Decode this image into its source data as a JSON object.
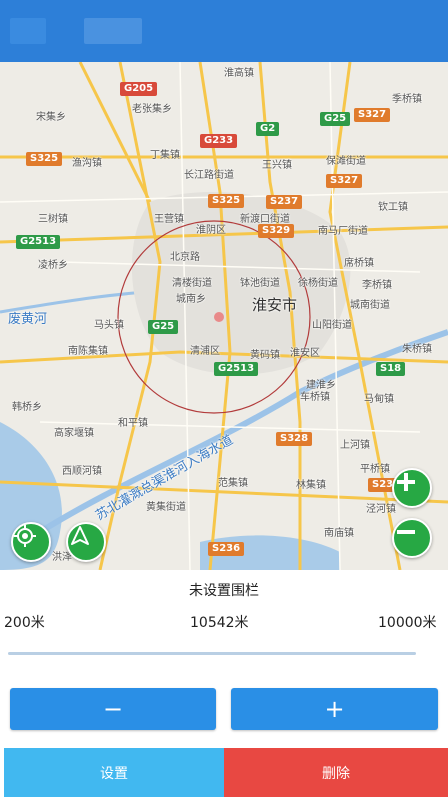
{
  "map": {
    "city_label": "淮安市",
    "water_labels": {
      "river": "废黄河",
      "canal": "苏北灌溉总渠淮河入海水道"
    },
    "route_shields": [
      {
        "text": "G205",
        "color": "red"
      },
      {
        "text": "G233",
        "color": "red"
      },
      {
        "text": "G2",
        "color": "green"
      },
      {
        "text": "G25",
        "color": "green"
      },
      {
        "text": "S327",
        "color": "orange"
      },
      {
        "text": "S325",
        "color": "orange"
      },
      {
        "text": "S237",
        "color": "orange"
      },
      {
        "text": "S325",
        "color": "orange"
      },
      {
        "text": "S327",
        "color": "orange"
      },
      {
        "text": "G2513",
        "color": "green"
      },
      {
        "text": "S329",
        "color": "orange"
      },
      {
        "text": "G25",
        "color": "green"
      },
      {
        "text": "G2513",
        "color": "green"
      },
      {
        "text": "S18",
        "color": "green"
      },
      {
        "text": "S328",
        "color": "orange"
      },
      {
        "text": "S237",
        "color": "orange"
      },
      {
        "text": "S236",
        "color": "orange"
      }
    ],
    "places": [
      "淮高镇",
      "季桥镇",
      "老张集乡",
      "宋集乡",
      "渔沟镇",
      "丁集镇",
      "长江路街道",
      "王兴镇",
      "保滩街道",
      "三树镇",
      "王营镇",
      "淮阴区",
      "新渡口街道",
      "钦工镇",
      "凌桥乡",
      "北京路",
      "南马厂街道",
      "席桥镇",
      "清楼街道",
      "钵池街道",
      "徐杨街道",
      "李桥镇",
      "城南乡",
      "城南街道",
      "马头镇",
      "山阳街道",
      "南陈集镇",
      "淮安区",
      "清浦区",
      "黄码镇",
      "朱桥镇",
      "建淮乡",
      "韩桥乡",
      "车桥镇",
      "马甸镇",
      "高家堰镇",
      "和平镇",
      "上河镇",
      "西顺河镇",
      "平桥镇",
      "林集镇",
      "范集镇",
      "黄集街道",
      "泾河镇",
      "洪泽",
      "南庙镇"
    ]
  },
  "controls": {
    "locate_icon": "locate-icon",
    "compass_icon": "navigation-arrow-icon",
    "zoom_in_icon": "plus-icon",
    "zoom_out_icon": "minus-icon"
  },
  "panel": {
    "title": "未设置围栏",
    "min_label": "200米",
    "current_label": "10542米",
    "max_label": "10000米",
    "decrease_label": "−",
    "increase_label": "+"
  },
  "bottom": {
    "set_label": "设置",
    "delete_label": "删除"
  },
  "colors": {
    "header": "#2d7fd8",
    "accent_button": "#2a8fe6",
    "set_button": "#41b8f0",
    "delete_button": "#e84842",
    "fab_green": "#27a844",
    "fence_circle": "#b23b3b"
  }
}
